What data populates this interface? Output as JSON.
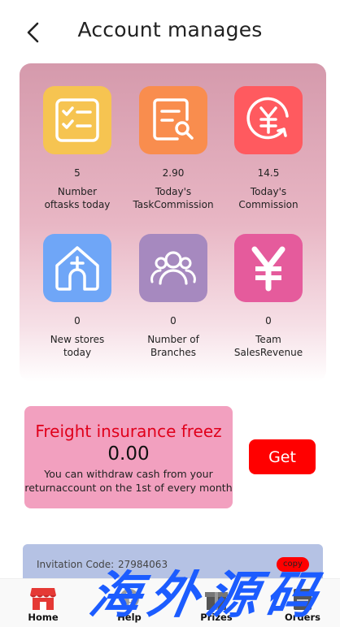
{
  "header": {
    "title": "Account manages"
  },
  "stats": [
    {
      "icon": "checklist-icon",
      "color": "#f6c451",
      "value": "5",
      "label": "Number\noftasks today"
    },
    {
      "icon": "document-search-icon",
      "color": "#f98d4e",
      "value": "2.90",
      "label": "Today's\nTaskCommission"
    },
    {
      "icon": "yen-refresh-icon",
      "color": "#ff5a5f",
      "value": "14.5",
      "label": "Today's\nCommission"
    },
    {
      "icon": "store-add-icon",
      "color": "#6fa6f7",
      "value": "0",
      "label": "New stores\ntoday"
    },
    {
      "icon": "team-icon",
      "color": "#a689bf",
      "value": "0",
      "label": "Number of\nBranches"
    },
    {
      "icon": "yen-icon",
      "color": "#e55b9c",
      "value": "0",
      "label": "Team\nSalesRevenue"
    }
  ],
  "freight": {
    "title": "Freight insurance freez",
    "amount": "0.00",
    "description": "You can withdraw cash from your returnaccount on the 1st of every month",
    "button": "Get"
  },
  "invite": {
    "label": "Invitation Code:",
    "code": "27984063",
    "copy": "copy"
  },
  "nav": [
    {
      "icon": "shop-icon",
      "label": "Home"
    },
    {
      "icon": "help-icon",
      "label": "Help"
    },
    {
      "icon": "gift-icon",
      "label": "Prizes"
    },
    {
      "icon": "orders-icon",
      "label": "Orders"
    }
  ],
  "watermark": "海外源码",
  "colors": {
    "accent": "#ff0000",
    "freight_bg": "#f2a0bf",
    "invite_bg": "#b5c2e4"
  }
}
